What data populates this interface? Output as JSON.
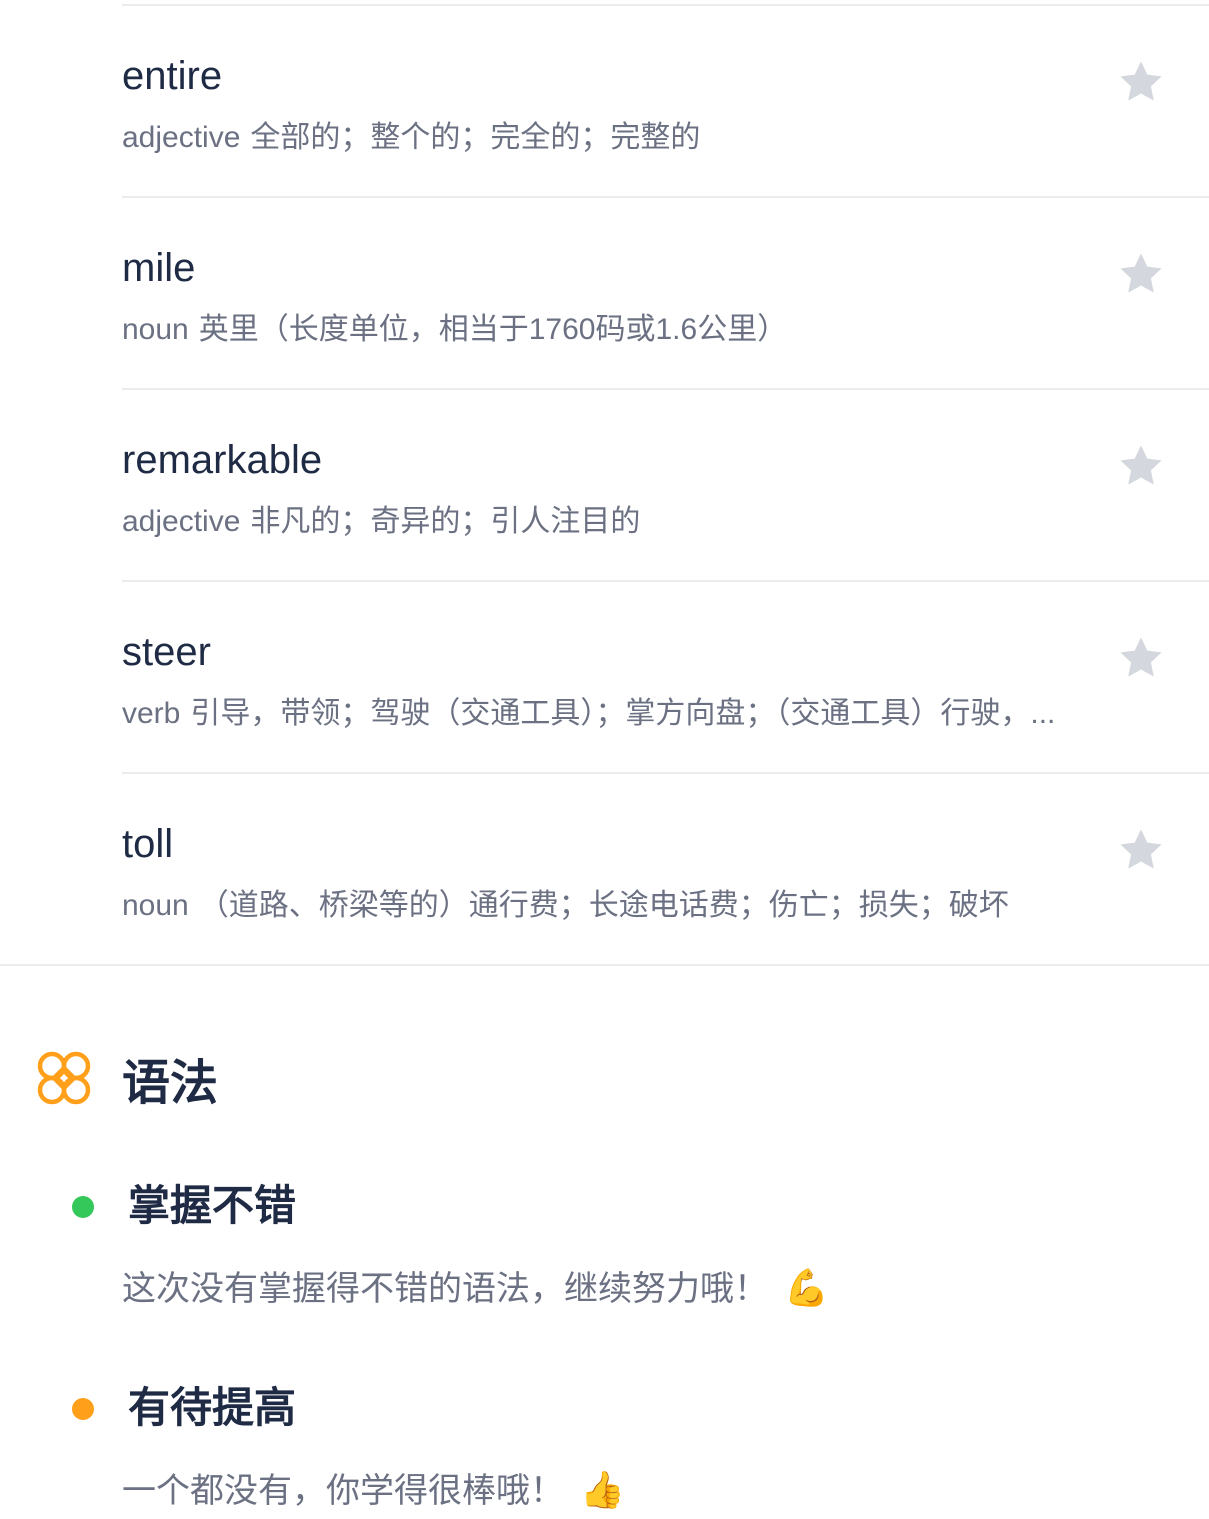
{
  "colors": {
    "star": "#d4d7de",
    "good_bullet": "#34c759",
    "improve_bullet": "#ff9f1a",
    "grammar_icon": "#ff9f1a"
  },
  "words": [
    {
      "word": "entire",
      "pos": "adjective",
      "definition": "全部的；整个的；完全的；完整的"
    },
    {
      "word": "mile",
      "pos": "noun",
      "definition": "英里（长度单位，相当于1760码或1.6公里）"
    },
    {
      "word": "remarkable",
      "pos": "adjective",
      "definition": "非凡的；奇异的；引人注目的"
    },
    {
      "word": "steer",
      "pos": "verb",
      "definition": "引导，带领；驾驶（交通工具）；掌方向盘；（交通工具）行驶，..."
    },
    {
      "word": "toll",
      "pos": "noun",
      "definition": "（道路、桥梁等的）通行费；长途电话费；伤亡；损失；破坏"
    }
  ],
  "grammar": {
    "title": "语法",
    "icon": "grammar-knot-icon",
    "good": {
      "title": "掌握不错",
      "text": "这次没有掌握得不错的语法，继续努力哦！",
      "emoji": "💪"
    },
    "improve": {
      "title": "有待提高",
      "text": "一个都没有，你学得很棒哦！",
      "emoji": "👍"
    }
  }
}
